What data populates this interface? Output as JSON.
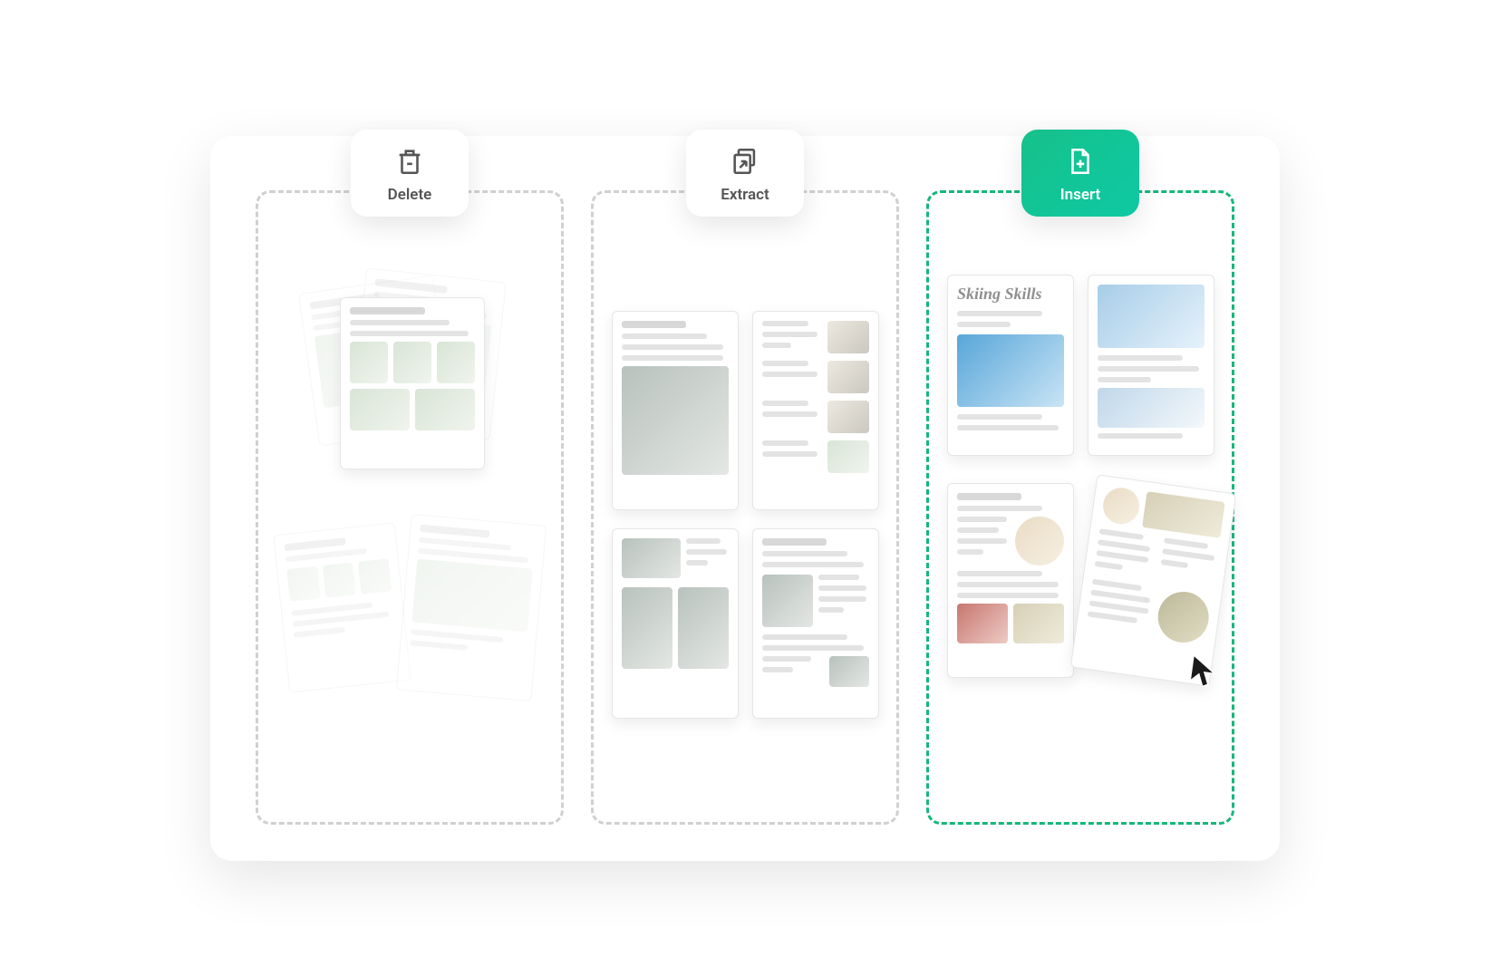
{
  "panels": {
    "delete": {
      "label": "Delete",
      "icon": "trash-minus-icon"
    },
    "extract": {
      "label": "Extract",
      "icon": "extract-arrow-icon"
    },
    "insert": {
      "label": "Insert",
      "icon": "page-plus-icon"
    }
  },
  "insert_content": {
    "card_title": "Skiing Skills"
  },
  "colors": {
    "accent": "#16b77a"
  }
}
